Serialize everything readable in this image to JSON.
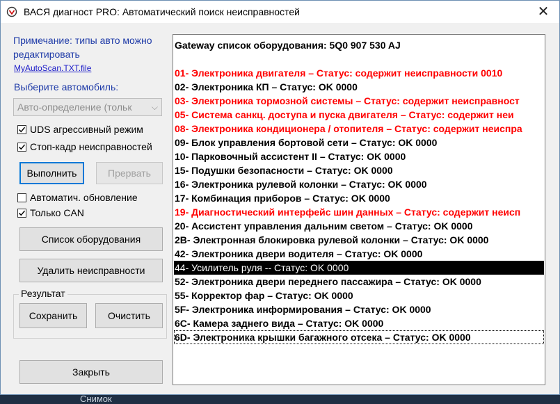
{
  "window": {
    "title": "ВАСЯ диагност PRO:  Автоматический поиск неисправностей",
    "close": "✕"
  },
  "left": {
    "note": "Примечание: типы авто можно редактировать",
    "link": "MyAutoScan.TXT.file",
    "choose_label": "Выберите автомобиль:",
    "select_value": "Авто-определение (тольк",
    "checks": [
      {
        "label": "UDS агрессивный режим",
        "checked": true
      },
      {
        "label": "Стоп-кадр неисправностей",
        "checked": true
      },
      {
        "label": "Автоматич. обновление",
        "checked": false
      },
      {
        "label": "Только CAN",
        "checked": true
      }
    ],
    "run_btn": "Выполнить",
    "abort_btn": "Прервать",
    "equipment_btn": "Список оборудования",
    "delete_btn": "Удалить неисправности",
    "result_group": "Результат",
    "save_btn": "Сохранить",
    "clear_btn": "Очистить",
    "close_btn": "Закрыть"
  },
  "list": {
    "rows": [
      {
        "text": "Gateway список оборудования:  5Q0 907 530 AJ",
        "color": "#000000"
      },
      {
        "text": "",
        "color": "#000000"
      },
      {
        "text": "01- Электроника двигателя – Статус: содержит неисправности 0010",
        "color": "#ff0000"
      },
      {
        "text": "02- Электроника КП – Статус: OK 0000",
        "color": "#000000"
      },
      {
        "text": "03- Электроника тормозной системы – Статус: содержит неисправност",
        "color": "#ff0000"
      },
      {
        "text": "05- Система санкц. доступа и пуска двигателя – Статус: содержит неи",
        "color": "#ff0000"
      },
      {
        "text": "08- Электроника кондиционера / отопителя – Статус: содержит неиспра",
        "color": "#ff0000"
      },
      {
        "text": "09- Блок управления бортовой сети – Статус: OK 0000",
        "color": "#000000"
      },
      {
        "text": "10- Парковочный ассистент II – Статус: OK 0000",
        "color": "#000000"
      },
      {
        "text": "15- Подушки безопасности – Статус: OK 0000",
        "color": "#000000"
      },
      {
        "text": "16- Электроника рулевой колонки – Статус: OK 0000",
        "color": "#000000"
      },
      {
        "text": "17- Комбинация приборов – Статус: OK 0000",
        "color": "#000000"
      },
      {
        "text": "19- Диагностический интерфейс шин данных – Статус: содержит неисп",
        "color": "#ff0000"
      },
      {
        "text": "20- Ассистент управления дальним светом – Статус: OK 0000",
        "color": "#000000"
      },
      {
        "text": "2B- Электронная блокировка рулевой колонки – Статус: OK 0000",
        "color": "#000000"
      },
      {
        "text": "42- Электроника двери водителя – Статус: OK 0000",
        "color": "#000000"
      },
      {
        "text": "44- Усилитель руля -- Статус: OK 0000",
        "color": "#ffffff",
        "selected": true
      },
      {
        "text": "52- Электроника двери переднего пассажира – Статус: OK 0000",
        "color": "#000000"
      },
      {
        "text": "55- Корректор фар – Статус: OK 0000",
        "color": "#000000"
      },
      {
        "text": "5F- Электроника информирования – Статус: OK 0000",
        "color": "#000000"
      },
      {
        "text": "6C- Камера заднего вида – Статус: OK 0000",
        "color": "#000000"
      },
      {
        "text": "6D- Электроника крышки багажного отсека – Статус: OK 0000",
        "color": "#000000",
        "focused": true
      }
    ]
  },
  "taskbar": {
    "text": "Снимок"
  }
}
